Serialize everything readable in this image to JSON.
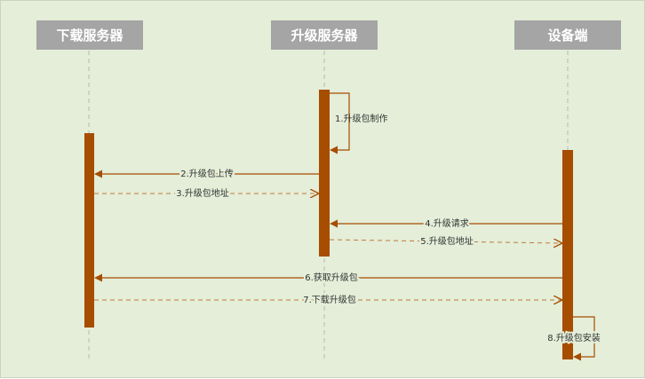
{
  "participants": {
    "download_server": "下载服务器",
    "upgrade_server": "升级服务器",
    "device": "设备端"
  },
  "messages": [
    {
      "label": "1.升级包制作",
      "from": "upgrade_server",
      "to": "upgrade_server",
      "style": "solid"
    },
    {
      "label": "2.升级包上传",
      "from": "upgrade_server",
      "to": "download_server",
      "style": "solid"
    },
    {
      "label": "3.升级包地址",
      "from": "download_server",
      "to": "upgrade_server",
      "style": "dashed"
    },
    {
      "label": "4.升级请求",
      "from": "device",
      "to": "upgrade_server",
      "style": "solid"
    },
    {
      "label": "5.升级包地址",
      "from": "upgrade_server",
      "to": "device",
      "style": "dashed"
    },
    {
      "label": "6.获取升级包",
      "from": "device",
      "to": "download_server",
      "style": "solid"
    },
    {
      "label": "7.下载升级包",
      "from": "download_server",
      "to": "device",
      "style": "dashed"
    },
    {
      "label": "8.升级包安装",
      "from": "device",
      "to": "device",
      "style": "solid"
    }
  ],
  "colors": {
    "background": "#e4eed9",
    "actor_box": "#a5a5a5",
    "activation": "#a64d00",
    "arrow": "#a64d00",
    "lifeline": "#b8b8b8"
  }
}
